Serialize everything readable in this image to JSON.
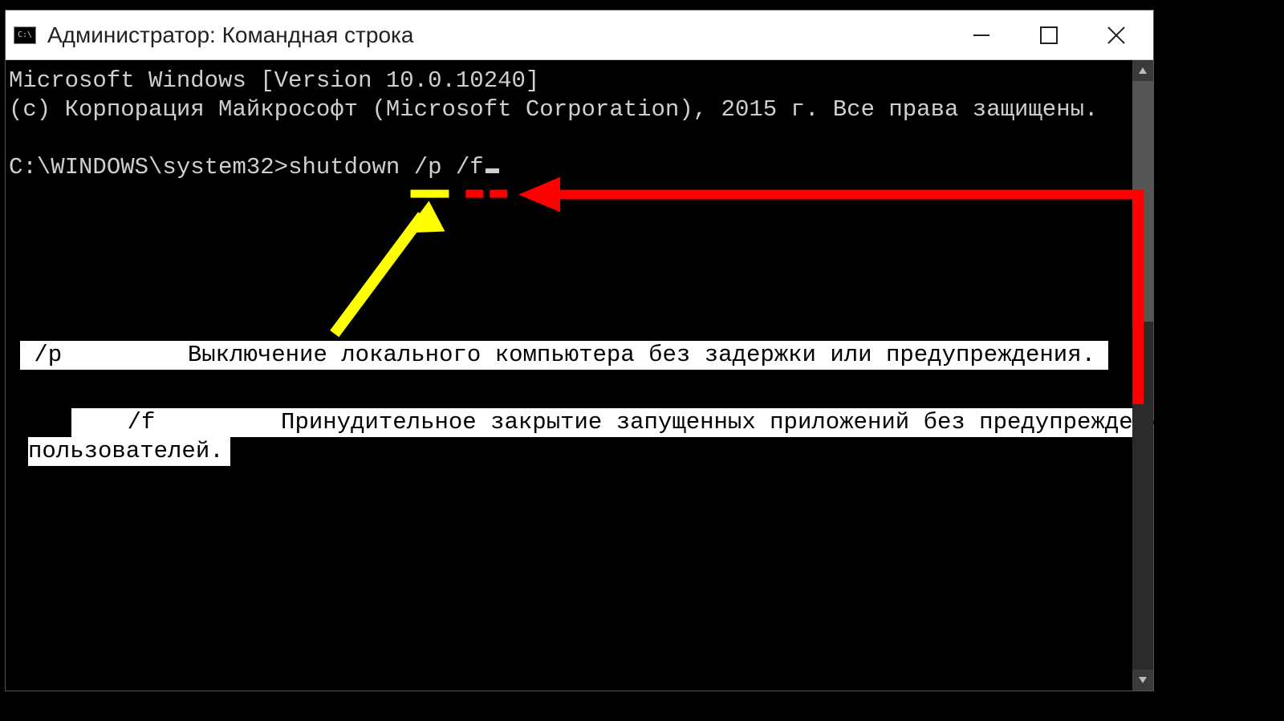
{
  "window": {
    "title": "Администратор: Командная строка",
    "icon_label": "C:\\"
  },
  "terminal": {
    "line1": "Microsoft Windows [Version 10.0.10240]",
    "line2": "(c) Корпорация Майкрософт (Microsoft Corporation), 2015 г. Все права защищены.",
    "blank": " ",
    "prompt": "C:\\WINDOWS\\system32>",
    "command": "shutdown /p /f"
  },
  "help": {
    "p_flag": " /p         Выключение локального компьютера без задержки или предупреждения.",
    "f_line1": "    /f         Принудительное закрытие запущенных приложений без предупреждения ",
    "f_line2": "пользователей."
  },
  "annotations": {
    "yellow_arrow": "points-to-/p-flag",
    "red_arrow": "points-to-/f-flag"
  }
}
